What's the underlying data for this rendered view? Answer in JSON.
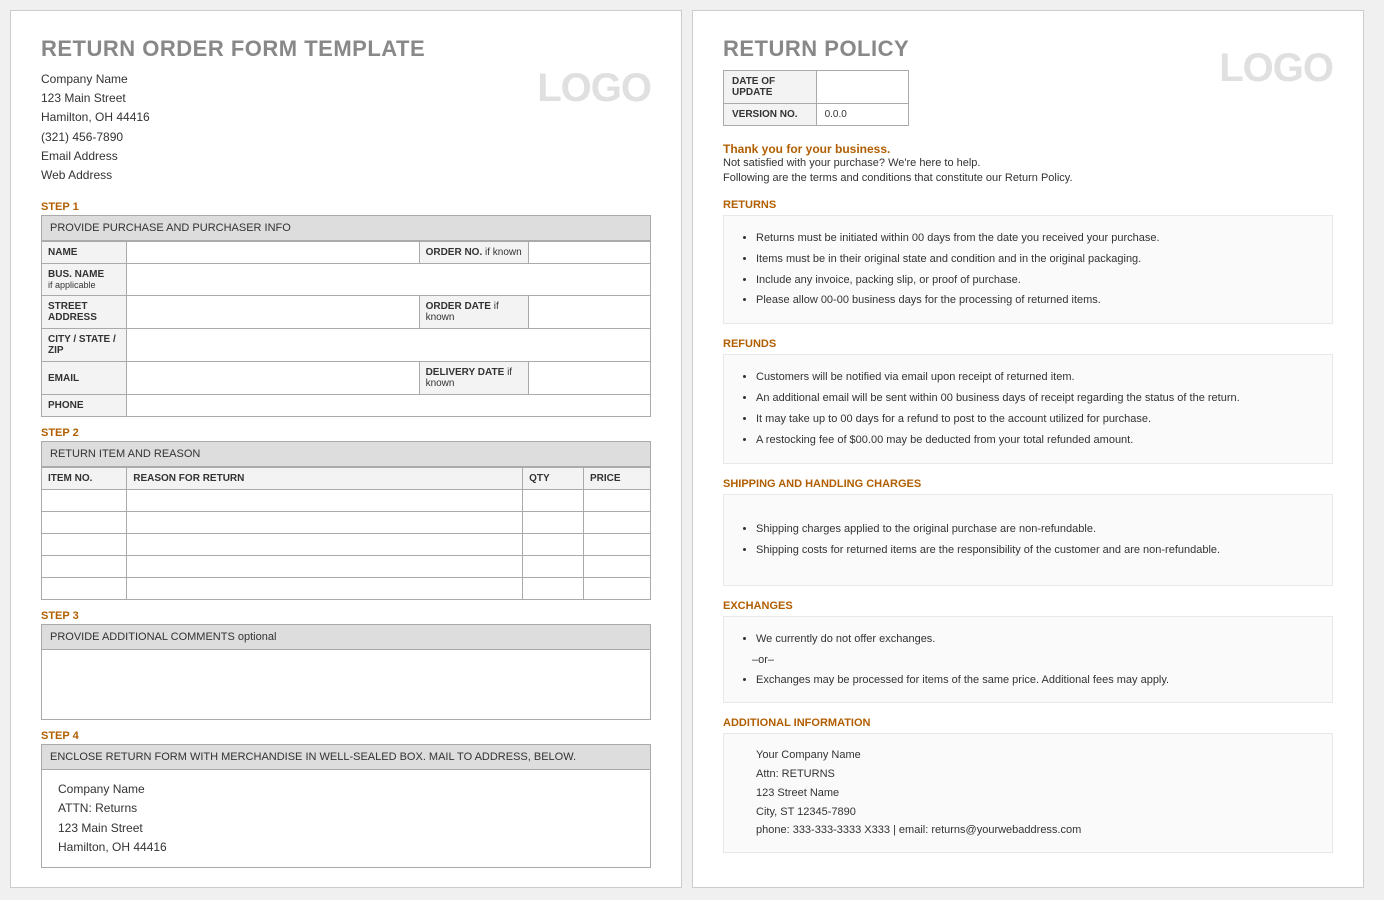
{
  "leftPage": {
    "title": "RETURN ORDER FORM TEMPLATE",
    "logo": "LOGO",
    "company": {
      "name": "Company Name",
      "street": "123 Main Street",
      "cityStateZip": "Hamilton, OH 44416",
      "phone": "(321) 456-7890",
      "email": "Email Address",
      "web": "Web Address"
    },
    "step1": {
      "label": "STEP 1",
      "header": "PROVIDE PURCHASE AND PURCHASER INFO",
      "rows": {
        "name": "NAME",
        "orderNoB": "ORDER NO.",
        "orderNoS": "if known",
        "busName": "BUS. NAME",
        "busNameSub": "if applicable",
        "streetAddr": "STREET ADDRESS",
        "orderDateB": "ORDER DATE",
        "orderDateS": "if known",
        "cityStateZip": "CITY / STATE / ZIP",
        "email": "EMAIL",
        "deliveryDateB": "DELIVERY DATE",
        "deliveryDateS": "if known",
        "phone": "PHONE"
      }
    },
    "step2": {
      "label": "STEP 2",
      "header": "RETURN ITEM AND REASON",
      "cols": {
        "itemNo": "ITEM NO.",
        "reason": "REASON FOR RETURN",
        "qty": "QTY",
        "price": "PRICE"
      }
    },
    "step3": {
      "label": "STEP 3",
      "headerMain": "PROVIDE ADDITIONAL COMMENTS",
      "headerOpt": "optional"
    },
    "step4": {
      "label": "STEP 4",
      "header": "ENCLOSE RETURN FORM WITH MERCHANDISE IN WELL-SEALED BOX.  MAIL TO ADDRESS, BELOW.",
      "mail": {
        "l1": "Company Name",
        "l2": "ATTN: Returns",
        "l3": "123 Main Street",
        "l4": "Hamilton, OH 44416"
      }
    }
  },
  "rightPage": {
    "title": "RETURN POLICY",
    "logo": "LOGO",
    "meta": {
      "dateLabel": "DATE OF UPDATE",
      "dateVal": "",
      "versionLabel": "VERSION NO.",
      "versionVal": "0.0.0"
    },
    "thanks": "Thank you for your business.",
    "intro1": "Not satisfied with your purchase? We're here to help.",
    "intro2": "Following are the terms and conditions that constitute our Return Policy.",
    "returns": {
      "title": "RETURNS",
      "b1": "Returns must be initiated within 00 days from the date you received your purchase.",
      "b2": "Items must be in their original state and condition and in the original packaging.",
      "b3": "Include any invoice, packing slip, or proof of purchase.",
      "b4": "Please allow 00-00 business days for the processing of returned items."
    },
    "refunds": {
      "title": "REFUNDS",
      "b1": "Customers will be notified via email upon receipt of returned item.",
      "b2": "An additional email will be sent within 00 business days of receipt regarding the status of the return.",
      "b3": "It may take up to 00 days for a refund to post to the account utilized for purchase.",
      "b4": "A restocking fee of $00.00 may be deducted from your total refunded amount."
    },
    "shipping": {
      "title": "SHIPPING AND HANDLING CHARGES",
      "b1": "Shipping charges applied to the original purchase are non-refundable.",
      "b2": "Shipping costs for returned items are the responsibility of the customer and are non-refundable."
    },
    "exchanges": {
      "title": "EXCHANGES",
      "b1": "We currently do not offer exchanges.",
      "or": "–or–",
      "b2": "Exchanges may be processed for items of the same price. Additional fees may apply."
    },
    "additional": {
      "title": "ADDITIONAL INFORMATION",
      "l1": "Your Company Name",
      "l2": "Attn: RETURNS",
      "l3": "123 Street Name",
      "l4": "City, ST  12345-7890",
      "l5": "phone: 333-333-3333 X333    |    email: returns@yourwebaddress.com"
    }
  }
}
